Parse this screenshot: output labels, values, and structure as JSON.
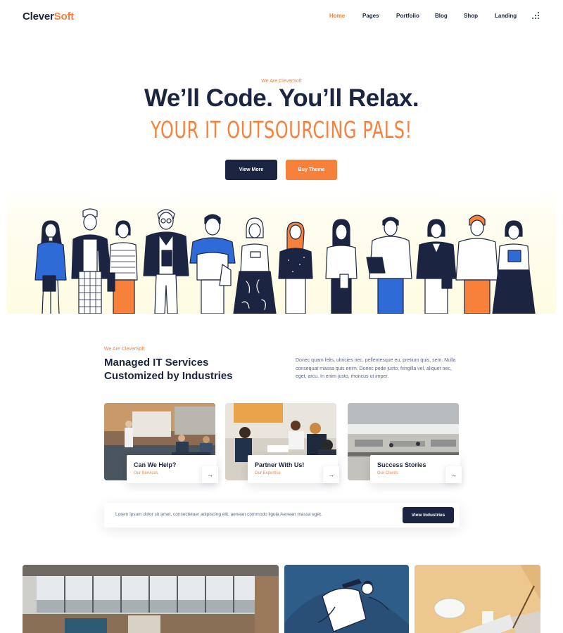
{
  "header": {
    "logo_part1": "Clever",
    "logo_part2": "Soft",
    "nav": [
      "Home",
      "Pages",
      "Portfolio",
      "Blog",
      "Shop",
      "Landing"
    ],
    "active_nav": "Home",
    "menu_icon": "grid-dots-icon"
  },
  "hero": {
    "eyebrow": "We Are CleverSoft",
    "title": "We’ll Code. You’ll Relax.",
    "subtitle": "Your IT Outsourcing Pals!",
    "btn_primary": "View More",
    "btn_secondary": "Buy Theme"
  },
  "services": {
    "eyebrow": "We Are CleverSoft",
    "title_line1": "Managed IT Services",
    "title_line2": "Customized by Industries",
    "description": "Donec quam felis, ultricies nec, pellentesque eu, pretium quis, sem. Nulla consequat massa quis enim. Donec pede justo, fringilla vel, aliquet nec, eget, arcu. In enim justo, rhoncus ut imper.",
    "cards": [
      {
        "title": "Can We Help?",
        "subtitle": "Our Services",
        "arrow": "→"
      },
      {
        "title": "Partner With Us!",
        "subtitle": "Our Expertise",
        "arrow": "→"
      },
      {
        "title": "Success Stories",
        "subtitle": "Our Clients",
        "arrow": "→"
      }
    ]
  },
  "cta": {
    "text": "Lorem ipsum dolor sit amet, consectetuer adipiscing elit, aenean commodo ligula Aenean massa eget.",
    "button": "View Industries"
  },
  "colors": {
    "navy": "#1b2541",
    "orange": "#f7813b",
    "blue": "#2f6bd6",
    "cream": "#fffbe2"
  }
}
